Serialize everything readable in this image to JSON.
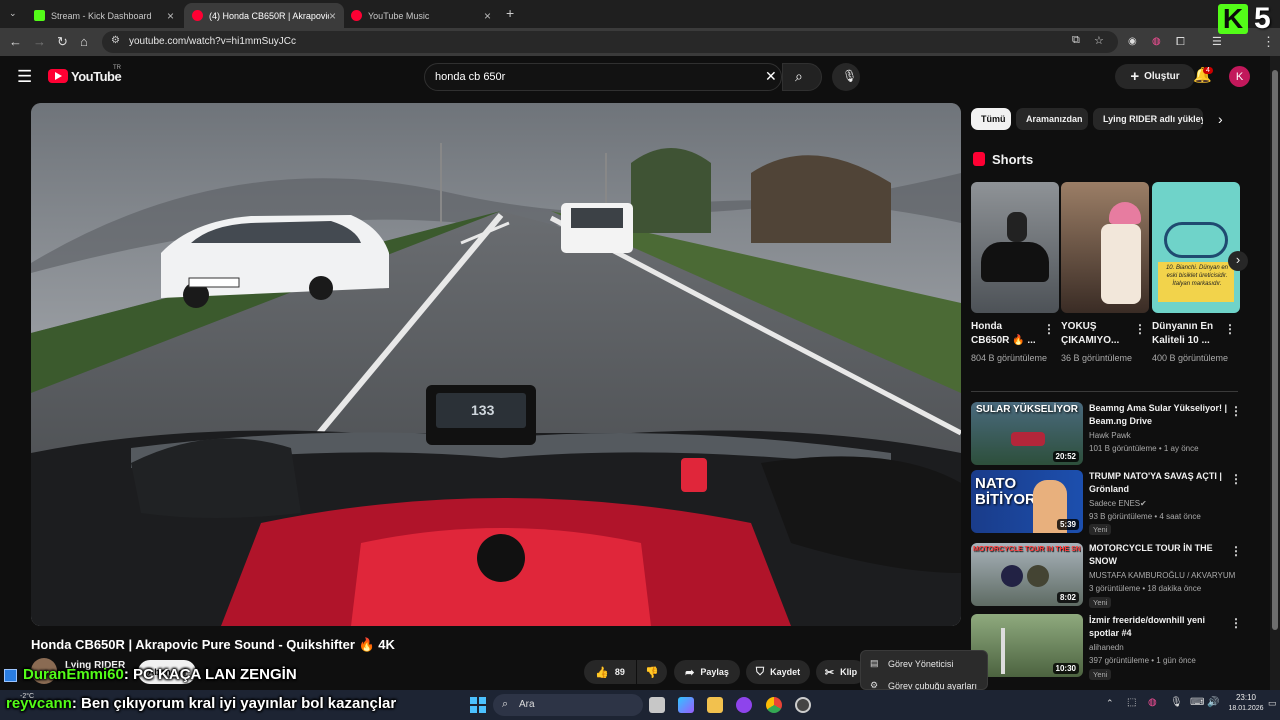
{
  "browser": {
    "tabs": [
      {
        "title": "Stream - Kick Dashboard",
        "color": "#53fc18"
      },
      {
        "title": "(4) Honda CB650R | Akrapovic P",
        "color": "#ff0033"
      },
      {
        "title": "YouTube Music",
        "color": "#ff0033"
      }
    ],
    "url": "youtube.com/watch?v=hi1mmSuyJCc"
  },
  "overlay_logo": {
    "letter": "K",
    "number": "5"
  },
  "youtube": {
    "logo_text": "YouTube",
    "region": "TR",
    "search_value": "honda cb 650r",
    "create_label": "Oluştur",
    "notification_count": "4",
    "account_initial": "K",
    "video": {
      "title": "Honda CB650R | Akrapovic Pure Sound - Quikshifter 🔥 4K",
      "channel": "Lying RIDER",
      "subscribe_label": "Abone ol",
      "like_count": "89",
      "share_label": "Paylaş",
      "save_label": "Kaydet",
      "clip_label": "Klip",
      "speedometer": "133"
    },
    "chips": [
      "Tümü",
      "Aramanızdan",
      "Lying RIDER adlı yükleyiciden"
    ],
    "shorts_heading": "Shorts",
    "shorts": [
      {
        "title": "Honda CB650R 🔥 ...",
        "views": "804 B görüntüleme"
      },
      {
        "title": "YOKUŞ ÇIKAMIYO...",
        "views": "36 B görüntüleme"
      },
      {
        "title": "Dünyanın En Kaliteli 10 ...",
        "views": "400 B görüntüleme",
        "thumb_text": "10. Bianchi. Dünyan en eski bisiklet üreticisidir. İtalyan markasıdır."
      }
    ],
    "recommendations": [
      {
        "title": "Beamng Ama Sular Yükseliyor! | Beam.ng Drive",
        "channel": "Hawk Pawk",
        "meta": "101 B görüntüleme • 1 ay önce",
        "duration": "20:52",
        "thumb_text": "SULAR YÜKSELİYOR"
      },
      {
        "title": "TRUMP NATO'YA SAVAŞ AÇTI | Grönland",
        "channel": "Sadece ENES",
        "meta": "93 B görüntüleme • 4 saat önce",
        "duration": "5:39",
        "badge": "Yeni",
        "thumb_text": "NATO BİTİYOR!"
      },
      {
        "title": "MOTORCYCLE TOUR İN THE SNOW",
        "channel": "MUSTAFA KAMBUROĞLU / AKVARYUM ...",
        "meta": "3 görüntüleme • 18 dakika önce",
        "duration": "8:02",
        "badge": "Yeni",
        "thumb_text": "MOTORCYCLE TOUR İN THE SNOW"
      },
      {
        "title": "İzmir freeride/downhill yeni spotlar #4",
        "channel": "alihanedn",
        "meta": "397 görüntüleme • 1 gün önce",
        "duration": "10:30",
        "badge": "Yeni"
      }
    ]
  },
  "context_menu": [
    "Görev Yöneticisi",
    "Görev çubuğu ayarları"
  ],
  "chat_overlay": [
    {
      "user": "DuranEmmi60",
      "message": ": PC KAÇA LAN ZENGİN",
      "user_color": "#53fc18"
    },
    {
      "user": "reyvcann",
      "message": ": Ben çıkıyorum kral iyi yayınlar bol kazançlar",
      "user_color": "#53fc18"
    }
  ],
  "taskbar": {
    "search_placeholder": "Ara",
    "weather": "-2°C",
    "time": "23:10",
    "date": "18.01.2026"
  }
}
